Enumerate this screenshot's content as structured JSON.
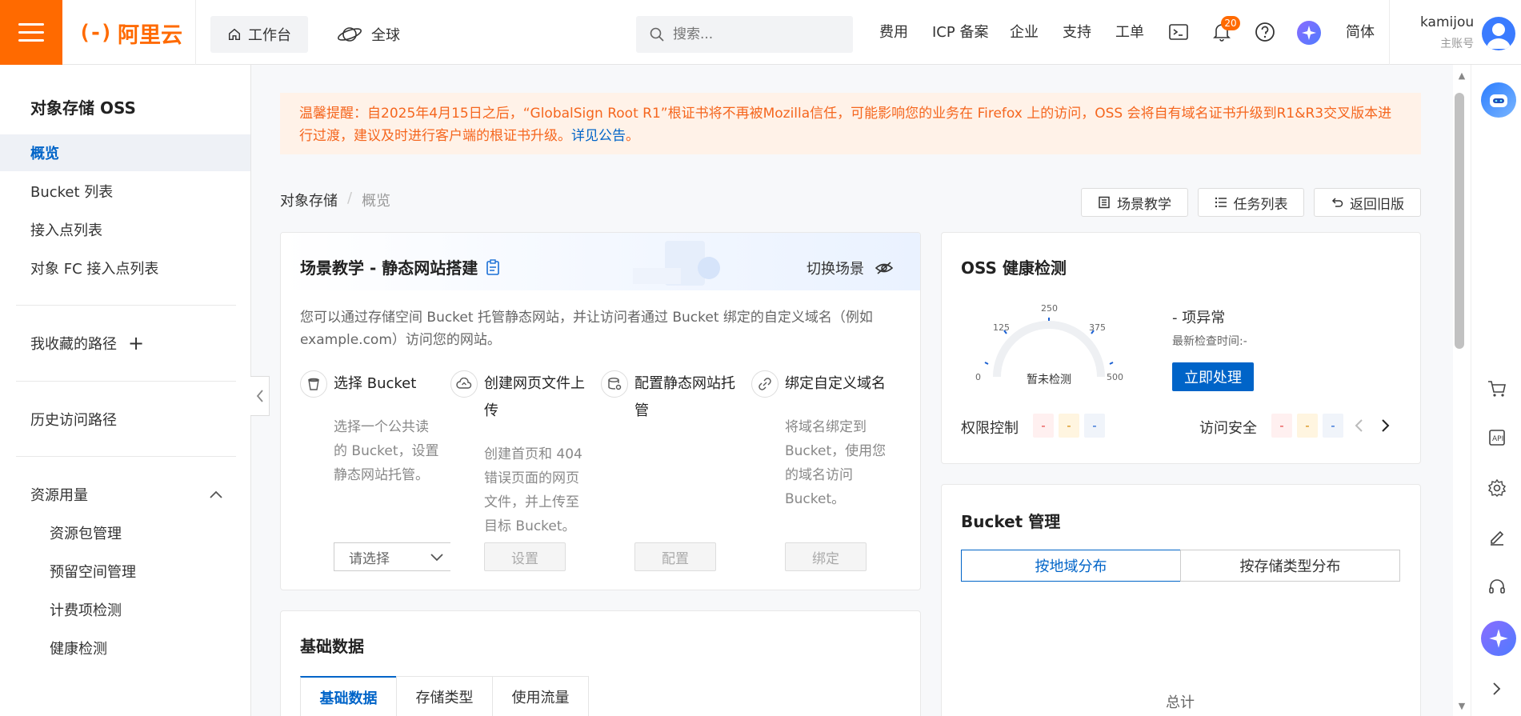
{
  "topbar": {
    "logo_text": "阿里云",
    "logo_mark": "(-)",
    "workbench": "工作台",
    "global": "全球",
    "search_placeholder": "搜索...",
    "links": [
      "费用",
      "ICP 备案",
      "企业",
      "支持",
      "工单"
    ],
    "notification_count": "20",
    "language": "简体",
    "user_name": "kamijou",
    "user_role": "主账号",
    "accent": "#ff6a00"
  },
  "sidebar": {
    "title": "对象存储 OSS",
    "items": [
      "概览",
      "Bucket 列表",
      "接入点列表",
      "对象 FC 接入点列表"
    ],
    "favorites": "我收藏的路径",
    "history": "历史访问路径",
    "resource_group": "资源用量",
    "resource_items": [
      "资源包管理",
      "预留空间管理",
      "计费项检测",
      "健康检测"
    ]
  },
  "notice": {
    "text": "温馨提醒：自2025年4月15日之后，“GlobalSign Root R1”根证书将不再被Mozilla信任，可能影响您的业务在 Firefox 上的访问，OSS 会将自有域名证书升级到R1&R3交叉版本进行过渡，建议及时进行客户端的根证书升级。",
    "link": "详见公告",
    "tail": "。"
  },
  "breadcrumb": {
    "root": "对象存储",
    "sep": "/",
    "current": "概览"
  },
  "header_buttons": {
    "tutorial": "场景教学",
    "tasks": "任务列表",
    "old": "返回旧版"
  },
  "scene": {
    "title": "场景教学 - 静态网站搭建",
    "switch": "切换场景",
    "desc": "您可以通过存储空间 Bucket 托管静态网站，并让访问者通过 Bucket 绑定的自定义域名（例如 example.com）访问您的网站。",
    "steps": [
      {
        "title": "选择 Bucket",
        "desc": "选择一个公共读的 Bucket，设置静态网站托管。",
        "icon": "bucket-icon"
      },
      {
        "title": "创建网页文件上传",
        "desc": "创建首页和 404 错误页面的网页文件，并上传至目标 Bucket。",
        "icon": "cloud-upload-icon"
      },
      {
        "title": "配置静态网站托管",
        "desc": "",
        "icon": "database-config-icon"
      },
      {
        "title": "绑定自定义域名",
        "desc": "将域名绑定到 Bucket，使用您的域名访问 Bucket。",
        "icon": "link-icon"
      }
    ],
    "select_placeholder": "请选择",
    "btn_set": "设置",
    "btn_config": "配置",
    "btn_bind": "绑定"
  },
  "basic_data": {
    "title": "基础数据",
    "tabs": [
      "基础数据",
      "存储类型",
      "使用流量"
    ]
  },
  "health": {
    "title": "OSS 健康检测",
    "gauge_ticks": [
      "0",
      "125",
      "250",
      "375",
      "500"
    ],
    "gauge_status": "暂未检测",
    "abnormal": "- 项异常",
    "check_time": "最新检查时间:-",
    "handle_btn": "立即处理",
    "perm_label": "权限控制",
    "access_label": "访问安全",
    "chip_value": "-"
  },
  "bucket_mgmt": {
    "title": "Bucket 管理",
    "tabs": [
      "按地域分布",
      "按存储类型分布"
    ],
    "total": "总计"
  }
}
